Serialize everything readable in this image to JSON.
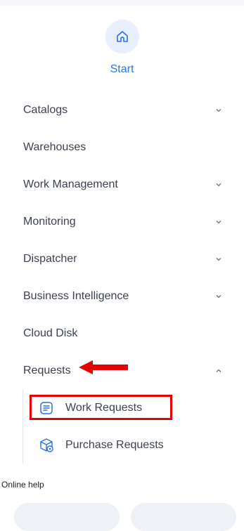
{
  "home": {
    "label": "Start",
    "icon": "home-icon"
  },
  "menu": [
    {
      "label": "Catalogs",
      "expand": "collapsed"
    },
    {
      "label": "Warehouses"
    },
    {
      "label": "Work Management",
      "expand": "collapsed"
    },
    {
      "label": "Monitoring",
      "expand": "collapsed"
    },
    {
      "label": "Dispatcher",
      "expand": "collapsed"
    },
    {
      "label": "Business Intelligence",
      "expand": "collapsed"
    },
    {
      "label": "Cloud Disk"
    },
    {
      "label": "Requests",
      "expand": "expanded"
    }
  ],
  "requests_submenu": [
    {
      "label": "Work Requests",
      "icon": "list-document-icon",
      "highlighted": true
    },
    {
      "label": "Purchase Requests",
      "icon": "box-settings-icon"
    }
  ],
  "footer": {
    "help_label": "Online help"
  },
  "colors": {
    "accent": "#2f6fe4",
    "highlight": "#e60000",
    "text": "#3c4250",
    "icon_bg": "#e8effd"
  }
}
